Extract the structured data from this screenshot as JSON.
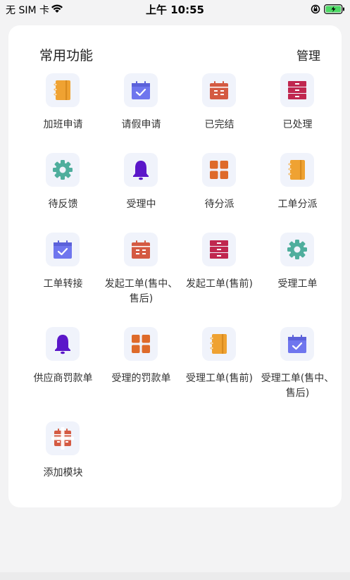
{
  "status_bar": {
    "carrier": "无 SIM 卡",
    "time": "上午 10:55"
  },
  "card": {
    "title": "常用功能",
    "manage_label": "管理"
  },
  "colors": {
    "orange": "#EFA232",
    "blue_purple": "#6F76EE",
    "red_orange": "#D45A42",
    "crimson": "#C0274F",
    "teal": "#4FAE9D",
    "purple": "#5B17C9",
    "tile_orange": "#DE6A2A"
  },
  "functions": [
    {
      "label": "加班申请",
      "icon": "notebook-icon"
    },
    {
      "label": "请假申请",
      "icon": "calendar-check-icon"
    },
    {
      "label": "已完结",
      "icon": "calendar-list-icon"
    },
    {
      "label": "已处理",
      "icon": "cabinet-icon"
    },
    {
      "label": "待反馈",
      "icon": "gear-icon"
    },
    {
      "label": "受理中",
      "icon": "bell-icon"
    },
    {
      "label": "待分派",
      "icon": "grid-icon"
    },
    {
      "label": "工单分派",
      "icon": "notebook-icon"
    },
    {
      "label": "工单转接",
      "icon": "calendar-check-icon"
    },
    {
      "label": "发起工单(售中、售后)",
      "icon": "calendar-list-icon"
    },
    {
      "label": "发起工单(售前)",
      "icon": "cabinet-icon"
    },
    {
      "label": "受理工单",
      "icon": "gear-icon"
    },
    {
      "label": "供应商罚款单",
      "icon": "bell-icon"
    },
    {
      "label": "受理的罚款单",
      "icon": "grid-icon"
    },
    {
      "label": "受理工单(售前)",
      "icon": "notebook-icon"
    },
    {
      "label": "受理工单(售中、售后)",
      "icon": "calendar-check-icon"
    },
    {
      "label": "添加模块",
      "icon": "add-module-icon"
    }
  ]
}
